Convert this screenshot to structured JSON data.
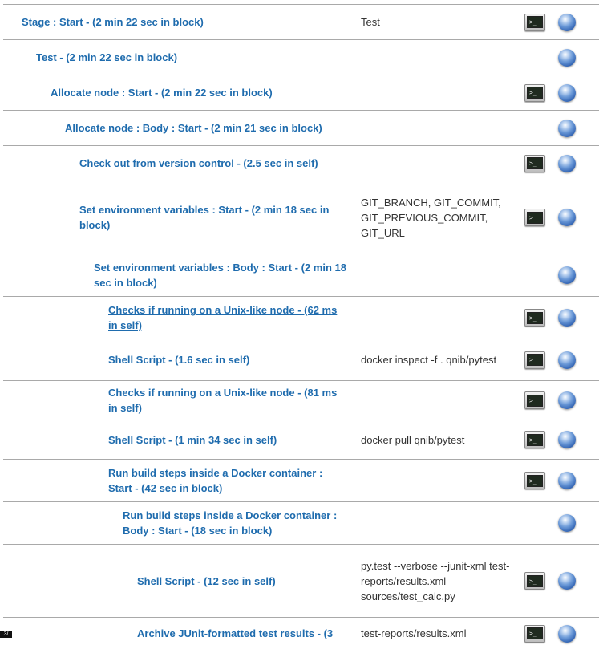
{
  "steps": [
    {
      "name": "Stage : Start - (2 min 22 sec in block)",
      "args": "Test",
      "console": true,
      "indent": 0,
      "underline": false
    },
    {
      "name": "Test - (2 min 22 sec in block)",
      "args": "",
      "console": false,
      "indent": 1,
      "underline": false
    },
    {
      "name": "Allocate node : Start - (2 min 22 sec in block)",
      "args": "",
      "console": true,
      "indent": 2,
      "underline": false
    },
    {
      "name": "Allocate node : Body : Start - (2 min 21 sec in block)",
      "args": "",
      "console": false,
      "indent": 3,
      "underline": false
    },
    {
      "name": "Check out from version control - (2.5 sec in self)",
      "args": "",
      "console": true,
      "indent": 4,
      "underline": false
    },
    {
      "name": "Set environment variables : Start - (2 min 18 sec in block)",
      "args": "GIT_BRANCH, GIT_COMMIT, GIT_PREVIOUS_COMMIT, GIT_URL",
      "console": true,
      "indent": 4,
      "underline": false
    },
    {
      "name": "Set environment variables : Body : Start - (2 min 18 sec in block)",
      "args": "",
      "console": false,
      "indent": 5,
      "underline": false
    },
    {
      "name": "Checks if running on a Unix-like node - (62 ms in self)",
      "args": "",
      "console": true,
      "indent": 6,
      "underline": true
    },
    {
      "name": "Shell Script - (1.6 sec in self)",
      "args": "docker inspect -f . qnib/pytest",
      "console": true,
      "indent": 6,
      "underline": false
    },
    {
      "name": "Checks if running on a Unix-like node - (81 ms in self)",
      "args": "",
      "console": true,
      "indent": 6,
      "underline": false
    },
    {
      "name": "Shell Script - (1 min 34 sec in self)",
      "args": "docker pull qnib/pytest",
      "console": true,
      "indent": 6,
      "underline": false
    },
    {
      "name": "Run build steps inside a Docker container : Start - (42 sec in block)",
      "args": "",
      "console": true,
      "indent": 6,
      "underline": false
    },
    {
      "name": "Run build steps inside a Docker container : Body : Start - (18 sec in block)",
      "args": "",
      "console": false,
      "indent": 7,
      "underline": false
    },
    {
      "name": "Shell Script - (12 sec in self)",
      "args": "py.test --verbose --junit-xml test-reports/results.xml sources/test_calc.py",
      "console": true,
      "indent": 8,
      "underline": false
    },
    {
      "name": "Archive JUnit-formatted test results - (3",
      "args": "test-reports/results.xml",
      "console": true,
      "indent": 8,
      "underline": false
    }
  ],
  "icons": {
    "console": "terminal-icon",
    "status": "blue-ball-status-icon"
  },
  "colors": {
    "link": "#1f6cae",
    "border": "#a9a9a9",
    "status": "#2d5fb0"
  },
  "corner_tab": "3/"
}
